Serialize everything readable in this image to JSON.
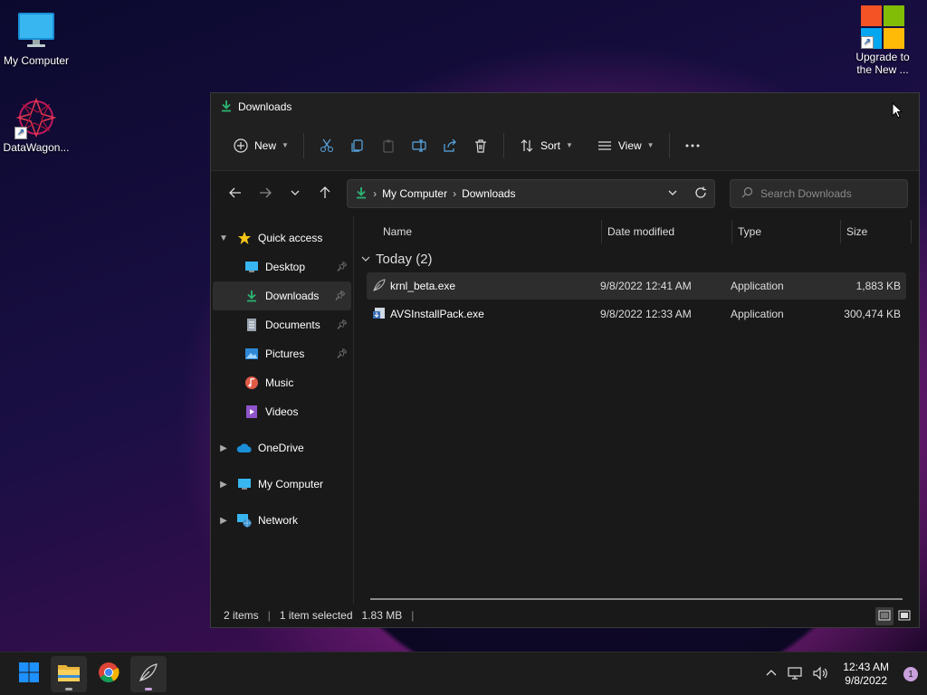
{
  "desktop": {
    "icons": [
      {
        "label": "My Computer"
      },
      {
        "label": "DataWagon..."
      },
      {
        "label_line1": "Upgrade to",
        "label_line2": "the New ..."
      }
    ]
  },
  "window": {
    "title": "Downloads",
    "toolbar": {
      "new_label": "New",
      "sort_label": "Sort",
      "view_label": "View"
    },
    "address": {
      "crumbs": [
        "My Computer",
        "Downloads"
      ]
    },
    "search": {
      "placeholder": "Search Downloads"
    },
    "nav": {
      "quick_access": "Quick access",
      "items": [
        {
          "label": "Desktop"
        },
        {
          "label": "Downloads"
        },
        {
          "label": "Documents"
        },
        {
          "label": "Pictures"
        },
        {
          "label": "Music"
        },
        {
          "label": "Videos"
        }
      ],
      "onedrive": "OneDrive",
      "my_computer": "My Computer",
      "network": "Network"
    },
    "columns": {
      "name": "Name",
      "date": "Date modified",
      "type": "Type",
      "size": "Size"
    },
    "group_label": "Today (2)",
    "files": [
      {
        "name": "krnl_beta.exe",
        "date": "9/8/2022 12:41 AM",
        "type": "Application",
        "size": "1,883 KB"
      },
      {
        "name": "AVSInstallPack.exe",
        "date": "9/8/2022 12:33 AM",
        "type": "Application",
        "size": "300,474 KB"
      }
    ],
    "status": {
      "items": "2 items",
      "selected": "1 item selected",
      "size": "1.83 MB"
    }
  },
  "taskbar": {
    "time": "12:43 AM",
    "date": "9/8/2022",
    "notifications": "1"
  },
  "colors": {
    "accent_green": "#2bb673",
    "folder_blue": "#4aa3df"
  }
}
